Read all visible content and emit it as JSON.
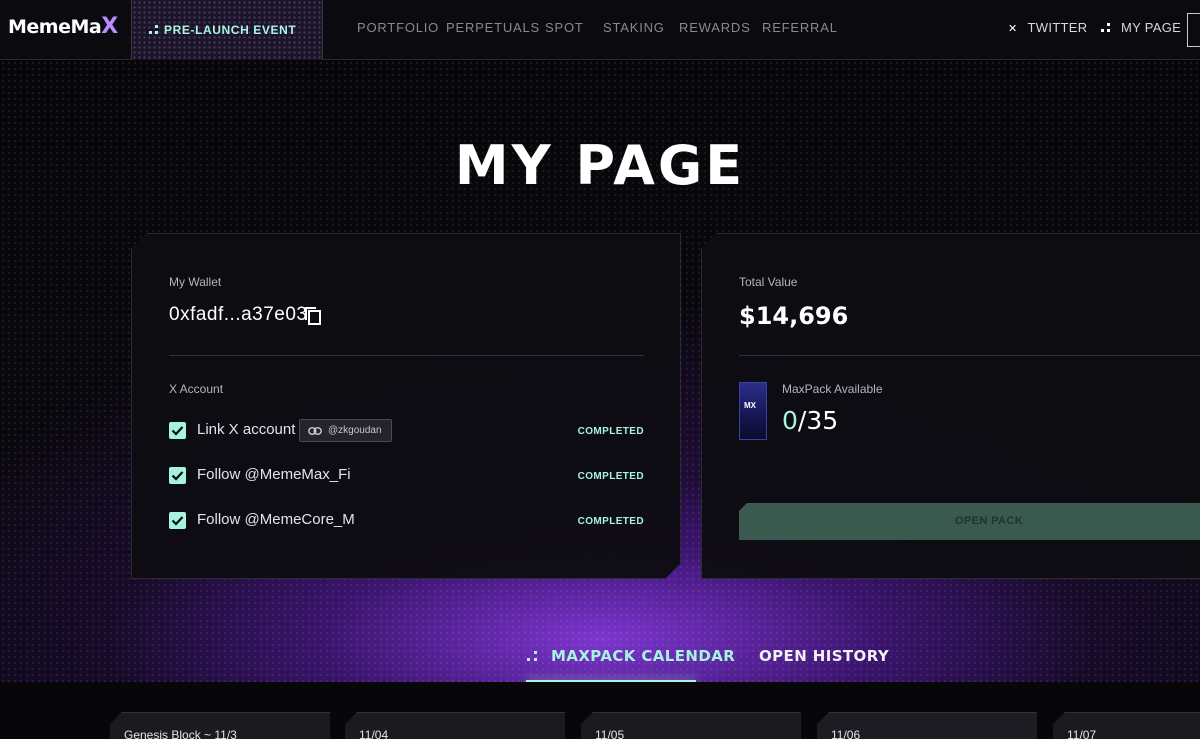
{
  "nav": {
    "logo_main": "MemeMa",
    "logo_x": "X",
    "event_label": "PRE-LAUNCH EVENT",
    "links": [
      "PORTFOLIO",
      "PERPETUALS",
      "SPOT",
      "STAKING",
      "REWARDS",
      "REFERRAL"
    ],
    "twitter_label": "TWITTER",
    "twitter_icon": "x-logo-icon",
    "mypage_label": "MY PAGE",
    "mypage_icon": "dots-icon"
  },
  "page": {
    "title": "MY PAGE"
  },
  "wallet_card": {
    "wallet_label": "My Wallet",
    "wallet_address": "0xfadf...a37e03",
    "x_account_label": "X Account",
    "tasks": [
      {
        "label": "Link X account",
        "status": "COMPLETED",
        "handle": "@zkgoudan",
        "checked": true
      },
      {
        "label": "Follow @MemeMax_Fi",
        "status": "COMPLETED",
        "checked": true
      },
      {
        "label": "Follow @MemeCore_M",
        "status": "COMPLETED",
        "checked": true
      }
    ]
  },
  "value_card": {
    "total_label": "Total Value",
    "total_value": "$14,696",
    "maxpack_label": "MaxPack Available",
    "maxpack_current": "0",
    "maxpack_total": "/35",
    "open_pack_label": "OPEN PACK"
  },
  "tabs": {
    "calendar": "MAXPACK CALENDAR",
    "history": "OPEN HISTORY"
  },
  "calendar": {
    "days": [
      "Genesis Block ~ 11/3",
      "11/04",
      "11/05",
      "11/06",
      "11/07"
    ],
    "selected_index": 3
  },
  "colors": {
    "accent": "#a6f3e0",
    "brand_purple": "#8a3cf0",
    "background": "#050407"
  }
}
